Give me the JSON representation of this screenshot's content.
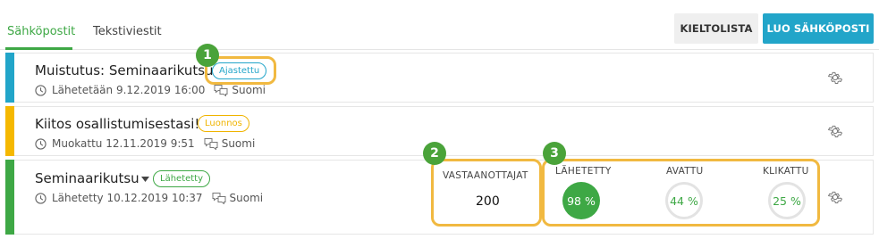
{
  "tabs": [
    {
      "label": "Sähköpostit",
      "active": true
    },
    {
      "label": "Tekstiviestit",
      "active": false
    }
  ],
  "toolbar": {
    "blocklist_label": "KIELTOLISTA",
    "create_email_label": "LUO SÄHKÖPOSTI"
  },
  "messages": [
    {
      "title": "Muistutus: Seminaarikutsu",
      "status": "Ajastettu",
      "status_color": "#22a5c9",
      "stripe_color": "#22a5c9",
      "date_text": "Lähetetään 9.12.2019 16:00",
      "language": "Suomi"
    },
    {
      "title": "Kiitos osallistumisestasi!",
      "status": "Luonnos",
      "status_color": "#f0b400",
      "stripe_color": "#f5b800",
      "date_text": "Muokattu 12.11.2019 9:51",
      "language": "Suomi"
    },
    {
      "title": "Seminaarikutsu",
      "status": "Lähetetty",
      "status_color": "#3ea845",
      "stripe_color": "#3ea845",
      "date_text": "Lähetetty 10.12.2019 10:37",
      "language": "Suomi",
      "stats": {
        "recipients_label": "VASTAANOTTAJAT",
        "recipients_value": "200",
        "sent_label": "LÄHETETTY",
        "sent_value": "98 %",
        "sent_fraction": 0.98,
        "opened_label": "AVATTU",
        "opened_value": "44 %",
        "opened_fraction": 0.44,
        "clicked_label": "KLIKATTU",
        "clicked_value": "25 %",
        "clicked_fraction": 0.25
      }
    }
  ],
  "annotations": [
    "1",
    "2",
    "3"
  ],
  "colors": {
    "accent_green": "#3ea845",
    "accent_blue": "#22a5c9",
    "highlight": "#f1b940"
  }
}
